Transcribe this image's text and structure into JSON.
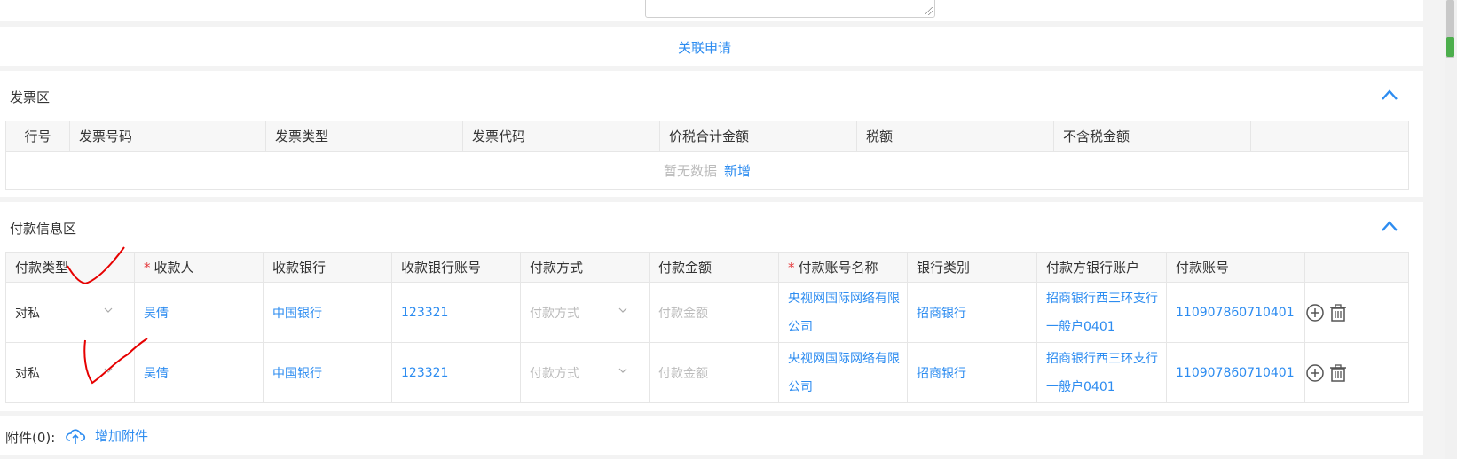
{
  "related": {
    "label": "关联申请"
  },
  "invoice": {
    "title": "发票区",
    "columns": [
      "行号",
      "发票号码",
      "发票类型",
      "发票代码",
      "价税合计金额",
      "税额",
      "不含税金额",
      ""
    ],
    "empty_text": "暂无数据",
    "add_label": "新增"
  },
  "payment": {
    "title": "付款信息区",
    "columns": [
      "付款类型",
      "收款人",
      "收款银行",
      "收款银行账号",
      "付款方式",
      "付款金额",
      "付款账号名称",
      "银行类别",
      "付款方银行账户",
      "付款账号",
      ""
    ],
    "required_mark": "*",
    "rows": [
      {
        "type": "对私",
        "payee": "吴倩",
        "payee_bank": "中国银行",
        "payee_account": "123321",
        "pay_method_placeholder": "付款方式",
        "amount_placeholder": "付款金额",
        "pay_account_name": "央视网国际网络有限公司",
        "bank_type": "招商银行",
        "payer_bank_account": "招商银行西三环支行一般户0401",
        "pay_account_no": "110907860710401"
      },
      {
        "type": "对私",
        "payee": "吴倩",
        "payee_bank": "中国银行",
        "payee_account": "123321",
        "pay_method_placeholder": "付款方式",
        "amount_placeholder": "付款金额",
        "pay_account_name": "央视网国际网络有限公司",
        "bank_type": "招商银行",
        "payer_bank_account": "招商银行西三环支行一般户0401",
        "pay_account_no": "110907860710401"
      }
    ]
  },
  "attachments": {
    "label": "附件(0):",
    "add_label": "增加附件"
  },
  "colors": {
    "accent": "#2d8cf0",
    "required": "#e4393c",
    "annotation": "#e60000"
  }
}
